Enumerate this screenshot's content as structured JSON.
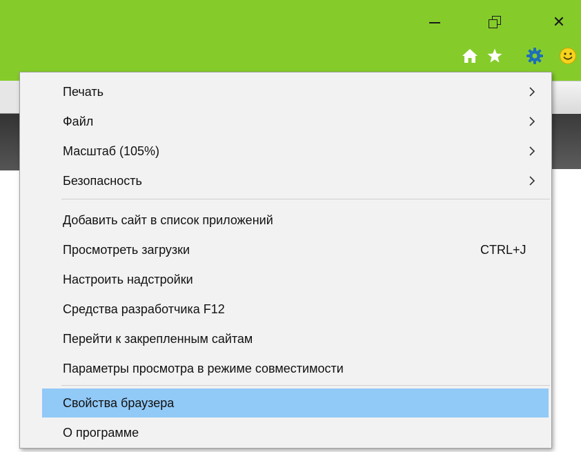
{
  "window": {
    "controls": {
      "minimize_icon": "minimize-icon",
      "restore_icon": "restore-icon",
      "close_icon": "close-icon",
      "close_glyph": "✕"
    },
    "toolbar_icons": [
      "home-icon",
      "star-icon",
      "gear-icon",
      "smiley-icon"
    ],
    "accent_color": "#85cc2b"
  },
  "menu": {
    "group1": [
      {
        "label": "Печать",
        "has_submenu": true
      },
      {
        "label": "Файл",
        "has_submenu": true
      },
      {
        "label": "Масштаб (105%)",
        "has_submenu": true
      },
      {
        "label": "Безопасность",
        "has_submenu": true
      }
    ],
    "group2": [
      {
        "label": "Добавить сайт в список приложений"
      },
      {
        "label": "Просмотреть загрузки",
        "shortcut": "CTRL+J"
      },
      {
        "label": "Настроить надстройки"
      },
      {
        "label": "Средства разработчика F12"
      },
      {
        "label": "Перейти к закрепленным сайтам"
      },
      {
        "label": "Параметры просмотра в режиме совместимости"
      }
    ],
    "group3": [
      {
        "label": "Свойства браузера",
        "highlighted": true
      },
      {
        "label": "О программе"
      }
    ],
    "highlight_color": "#91c9f7"
  }
}
